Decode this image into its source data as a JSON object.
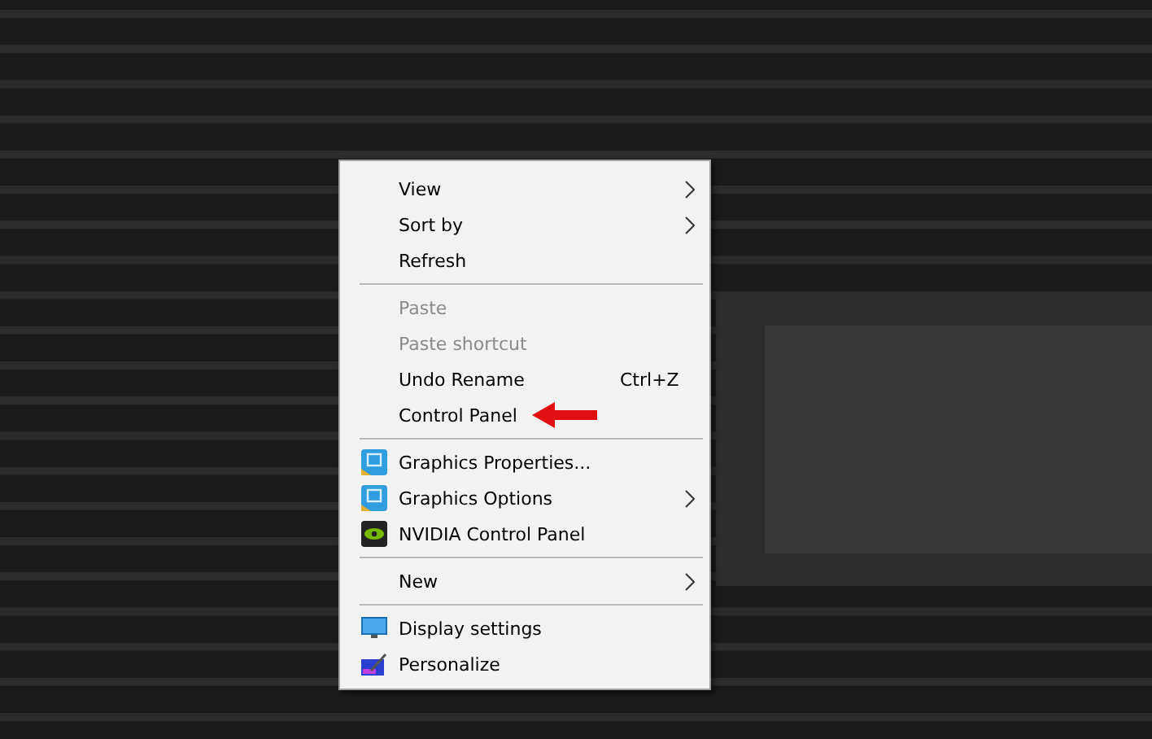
{
  "context_menu": {
    "groups": [
      {
        "items": [
          {
            "label": "View",
            "kind": "plain",
            "submenu": true,
            "disabled": false
          },
          {
            "label": "Sort by",
            "kind": "plain",
            "submenu": true,
            "disabled": false
          },
          {
            "label": "Refresh",
            "kind": "plain",
            "submenu": false,
            "disabled": false
          }
        ]
      },
      {
        "items": [
          {
            "label": "Paste",
            "kind": "plain",
            "submenu": false,
            "disabled": true
          },
          {
            "label": "Paste shortcut",
            "kind": "plain",
            "submenu": false,
            "disabled": true
          },
          {
            "label": "Undo Rename",
            "kind": "plain",
            "submenu": false,
            "disabled": false,
            "shortcut": "Ctrl+Z"
          },
          {
            "label": "Control Panel",
            "kind": "plain",
            "submenu": false,
            "disabled": false,
            "pointed": true
          }
        ]
      },
      {
        "items": [
          {
            "label": "Graphics Properties...",
            "kind": "graphics",
            "submenu": false,
            "disabled": false
          },
          {
            "label": "Graphics Options",
            "kind": "graphics",
            "submenu": true,
            "disabled": false
          },
          {
            "label": "NVIDIA Control Panel",
            "kind": "nvidia",
            "submenu": false,
            "disabled": false
          }
        ]
      },
      {
        "items": [
          {
            "label": "New",
            "kind": "plain",
            "submenu": true,
            "disabled": false
          }
        ]
      },
      {
        "items": [
          {
            "label": "Display settings",
            "kind": "display",
            "submenu": false,
            "disabled": false
          },
          {
            "label": "Personalize",
            "kind": "personalize",
            "submenu": false,
            "disabled": false
          }
        ]
      }
    ]
  }
}
